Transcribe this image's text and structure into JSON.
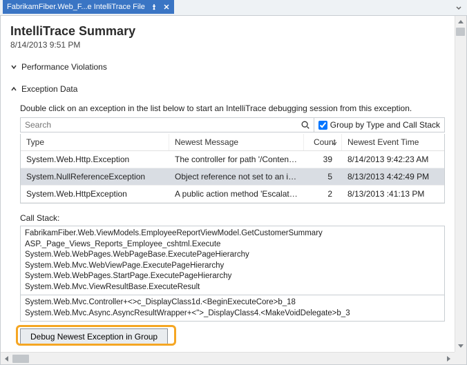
{
  "tab": {
    "title": "FabrikamFiber.Web_F...e IntelliTrace File"
  },
  "summary": {
    "title": "IntelliTrace Summary",
    "timestamp": "8/14/2013 9:51 PM"
  },
  "sections": {
    "performance": {
      "label": "Performance Violations",
      "expanded": false
    },
    "exceptions": {
      "label": "Exception Data",
      "expanded": true,
      "hint": "Double click on an exception in the list below to start an IntelliTrace debugging session from this exception.",
      "search_placeholder": "Search",
      "group_label": "Group by Type and Call Stack",
      "group_checked": true,
      "columns": {
        "type": "Type",
        "message": "Newest Message",
        "count": "Count",
        "time": "Newest Event Time"
      },
      "rows": [
        {
          "type": "System.Web.Http.Exception",
          "message": "The controller for path '/Contents/fonts...",
          "count": 39,
          "time": "8/14/2013 9:42:23 AM",
          "selected": false
        },
        {
          "type": "System.NullReferenceException",
          "message": "Object reference not set to an instance...",
          "count": 5,
          "time": "8/13/2013 4:42:49 PM",
          "selected": true
        },
        {
          "type": "System.Web.HttpException",
          "message": "A public action method 'Escalate' was...",
          "count": 2,
          "time": "8/13/2013 :41:13 PM",
          "selected": false
        }
      ],
      "callstack_label": "Call Stack:",
      "callstack1": [
        "FabrikamFiber.Web.ViewModels.EmployeeReportViewModel.GetCustomerSummary",
        "ASP._Page_Views_Reports_Employee_cshtml.Execute",
        "System.Web.WebPages.WebPageBase.ExecutePageHierarchy",
        "System.Web.Mvc.WebViewPage.ExecutePageHierarchy",
        "System.Web.WebPages.StartPage.ExecutePageHierarchy",
        "System.Web.Mvc.ViewResultBase.ExecuteResult"
      ],
      "callstack2": [
        "System.Web.Mvc.Controller+<>c_DisplayClass1d.<BeginExecuteCore>b_18",
        "System.Web.Mvc.Async.AsyncResultWrapper+<\">_DisplayClass4.<MakeVoidDelegate>b_3"
      ],
      "debug_button": "Debug Newest Exception in Group"
    }
  }
}
